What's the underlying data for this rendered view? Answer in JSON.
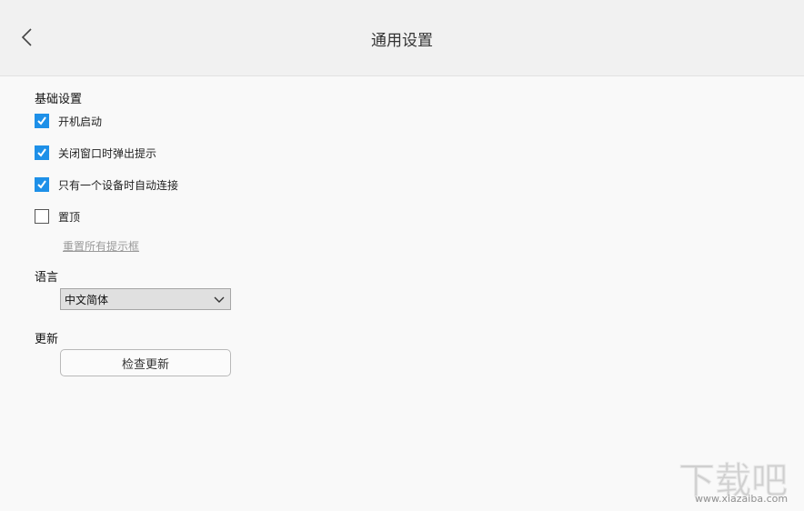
{
  "header": {
    "title": "通用设置",
    "back_icon": "chevron-left-icon"
  },
  "basic": {
    "title": "基础设置",
    "options": [
      {
        "label": "开机启动",
        "checked": true
      },
      {
        "label": "关闭窗口时弹出提示",
        "checked": true
      },
      {
        "label": "只有一个设备时自动连接",
        "checked": true
      },
      {
        "label": "置顶",
        "checked": false
      }
    ],
    "reset_link": "重置所有提示框"
  },
  "language": {
    "title": "语言",
    "selected": "中文简体"
  },
  "update": {
    "title": "更新",
    "button_label": "检查更新"
  },
  "watermark": {
    "text": "下载吧",
    "url": "www.xiazaiba.com"
  },
  "colors": {
    "checkbox_checked": "#1e90e8",
    "header_bg": "#f1f1f1",
    "page_bg": "#f9f9f9"
  }
}
